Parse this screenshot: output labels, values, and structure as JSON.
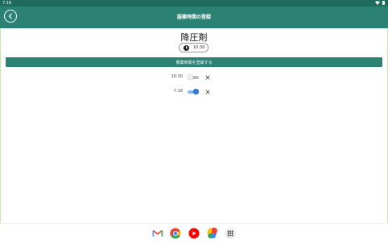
{
  "status_bar": {
    "time": "7:16"
  },
  "app_bar": {
    "title": "服薬時間の登録"
  },
  "medicine": {
    "name": "降圧剤"
  },
  "time_picker": {
    "value": "10:30"
  },
  "register_button": {
    "label": "服薬時間を登録する"
  },
  "schedules": [
    {
      "time": "10:30",
      "enabled": false
    },
    {
      "time": "7:16",
      "enabled": true
    }
  ],
  "dock": {
    "apps": [
      "gmail-icon",
      "chrome-icon",
      "youtube-icon",
      "photos-icon",
      "app-drawer-icon"
    ]
  },
  "colors": {
    "status_bar": "#1f6b5e",
    "app_bar": "#2b8172",
    "toggle_on": "#2e7ad6"
  }
}
